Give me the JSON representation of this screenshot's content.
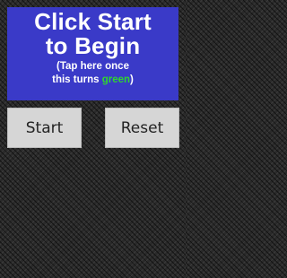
{
  "banner": {
    "line1": "Click Start",
    "line2": "to Begin",
    "hint_line1": "(Tap here once",
    "hint_line2_prefix": "this turns ",
    "hint_line2_color_word": "green",
    "hint_line2_suffix": ")",
    "background_color": "#3a3ac8",
    "highlight_color": "#2fd52f"
  },
  "buttons": {
    "start_label": "Start",
    "reset_label": "Reset"
  }
}
